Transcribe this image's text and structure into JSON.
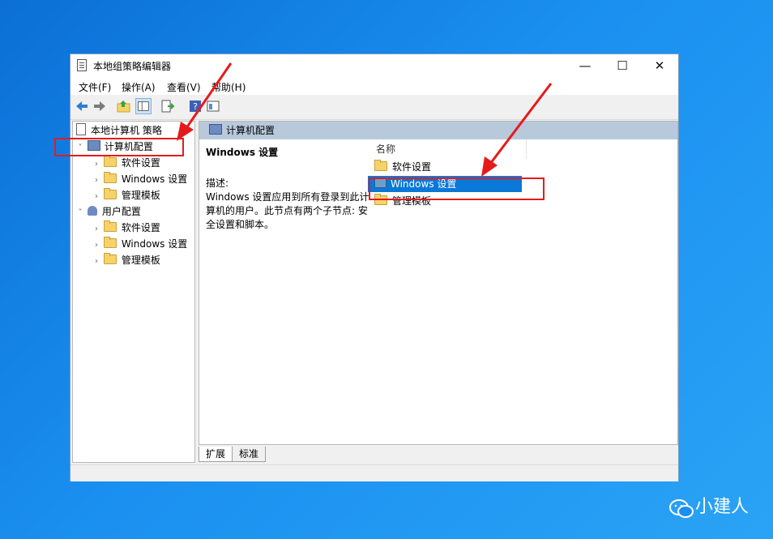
{
  "window": {
    "title": "本地组策略编辑器",
    "minimize": "—",
    "maximize": "☐",
    "close": "✕"
  },
  "menu": [
    "文件(F)",
    "操作(A)",
    "查看(V)",
    "帮助(H)"
  ],
  "toolbar": {
    "icons": [
      "back-arrow-icon",
      "forward-arrow-icon",
      "up-folder-icon",
      "show-tree-icon",
      "export-list-icon",
      "help-icon",
      "properties-icon"
    ]
  },
  "tree": {
    "root": "本地计算机 策略",
    "computer": {
      "label": "计算机配置",
      "children": [
        "软件设置",
        "Windows 设置",
        "管理模板"
      ]
    },
    "user": {
      "label": "用户配置",
      "children": [
        "软件设置",
        "Windows 设置",
        "管理模板"
      ]
    }
  },
  "right": {
    "header": "计算机配置",
    "desc_title": "Windows 设置",
    "desc_label": "描述:",
    "desc_text": "Windows 设置应用到所有登录到此计算机的用户。此节点有两个子节点: 安全设置和脚本。",
    "column": "名称",
    "items": [
      "软件设置",
      "Windows 设置",
      "管理模板"
    ],
    "selected_index": 1
  },
  "tabs": [
    "扩展",
    "标准"
  ],
  "watermark": "小建人",
  "colors": {
    "annotation": "#e51b1b",
    "selection": "#0a78d7"
  }
}
